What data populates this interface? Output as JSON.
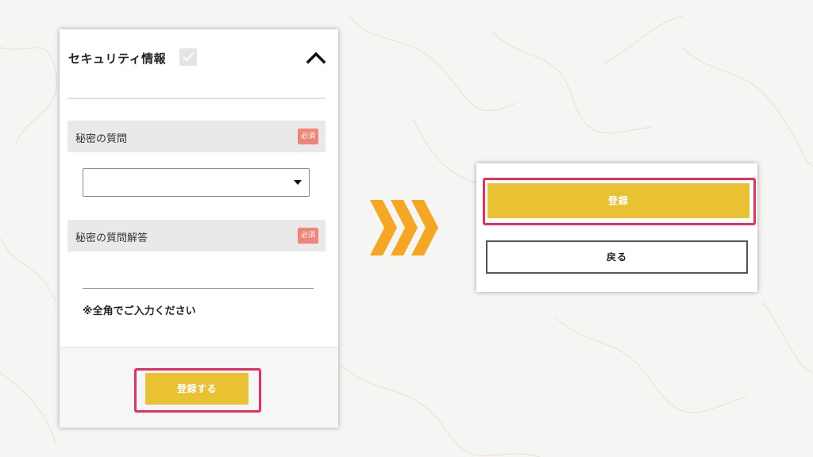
{
  "left_form": {
    "section_title": "セキュリティ情報",
    "secret_question": {
      "label": "秘密の質問",
      "required_badge": "必須",
      "selected_value": ""
    },
    "secret_answer": {
      "label": "秘密の質問解答",
      "required_badge": "必須",
      "value": ""
    },
    "note": "※全角でご入力ください",
    "submit_label": "登録する"
  },
  "right_form": {
    "register_label": "登録",
    "back_label": "戻る"
  },
  "icons": {
    "section_check": "check-icon",
    "collapse": "chevron-up-icon",
    "select_caret": "caret-down-icon",
    "transition": "triple-chevron-right-icon"
  },
  "colors": {
    "button_yellow": "#e8c232",
    "highlight_pink": "#e8305d",
    "required_badge": "#f08478",
    "arrow_orange": "#f5a623"
  }
}
